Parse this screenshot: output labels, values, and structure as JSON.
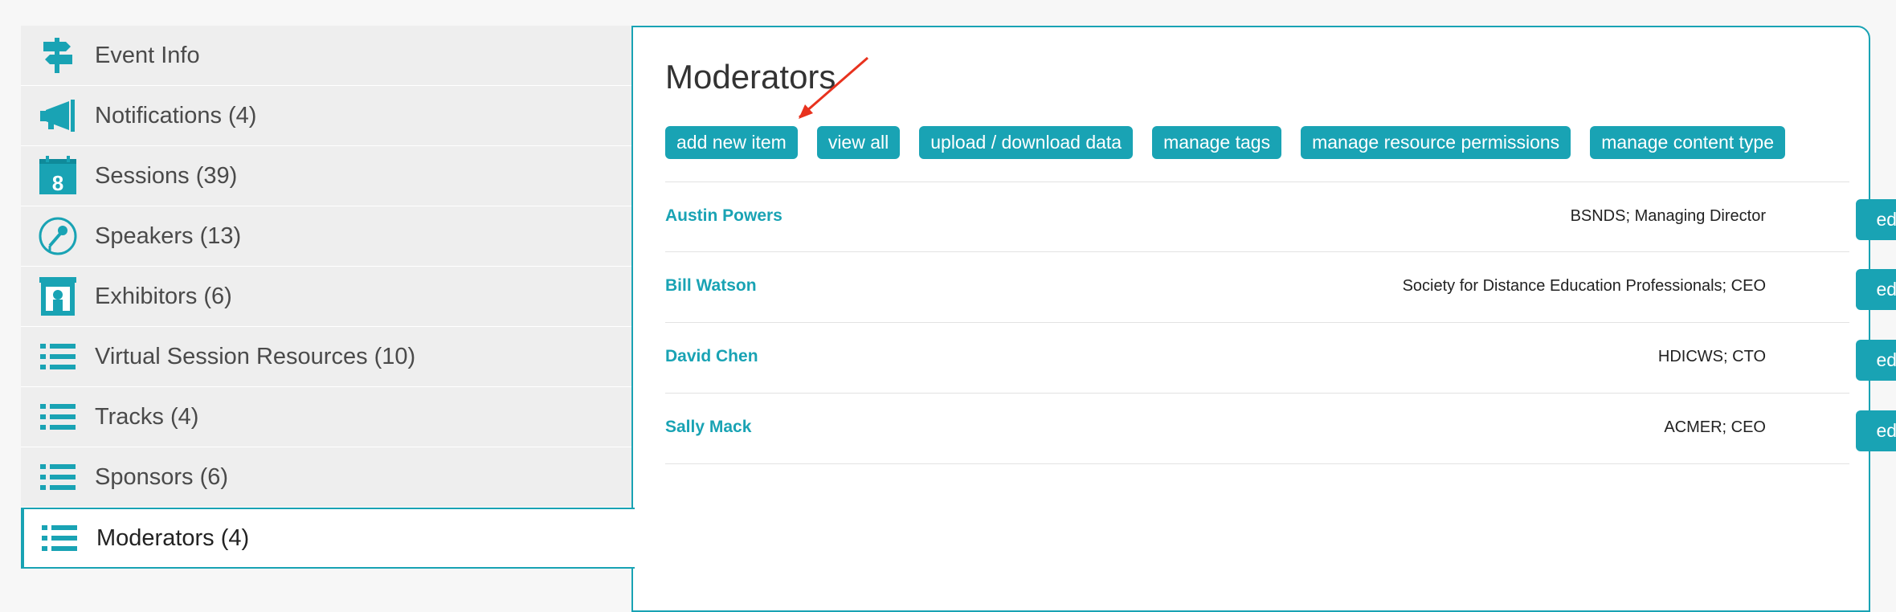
{
  "sidebar": {
    "items": [
      {
        "label": "Event Info",
        "icon": "signpost-icon"
      },
      {
        "label": "Notifications (4)",
        "icon": "megaphone-icon"
      },
      {
        "label": "Sessions (39)",
        "icon": "calendar-icon"
      },
      {
        "label": "Speakers (13)",
        "icon": "microphone-icon"
      },
      {
        "label": "Exhibitors (6)",
        "icon": "booth-icon"
      },
      {
        "label": "Virtual Session Resources (10)",
        "icon": "list-icon"
      },
      {
        "label": "Tracks (4)",
        "icon": "list-icon"
      },
      {
        "label": "Sponsors (6)",
        "icon": "list-icon"
      },
      {
        "label": "Moderators (4)",
        "icon": "list-icon"
      }
    ],
    "active": "Moderators (4)"
  },
  "main": {
    "title": "Moderators",
    "toolbar": {
      "add_new": "add new item",
      "view_all": "view all",
      "upload": "upload / download data",
      "tags": "manage tags",
      "permissions": "manage resource permissions",
      "content_type": "manage content type"
    },
    "rows": [
      {
        "name": "Austin Powers",
        "org": "BSNDS; Managing Director",
        "action": "edit"
      },
      {
        "name": "Bill Watson",
        "org": "Society for Distance Education Professionals; CEO",
        "action": "edit"
      },
      {
        "name": "David Chen",
        "org": "HDICWS; CTO",
        "action": "edit"
      },
      {
        "name": "Sally Mack",
        "org": "ACMER; CEO",
        "action": "edit"
      }
    ]
  },
  "colors": {
    "accent": "#19a3b4",
    "annotation_arrow": "#e8321e"
  }
}
